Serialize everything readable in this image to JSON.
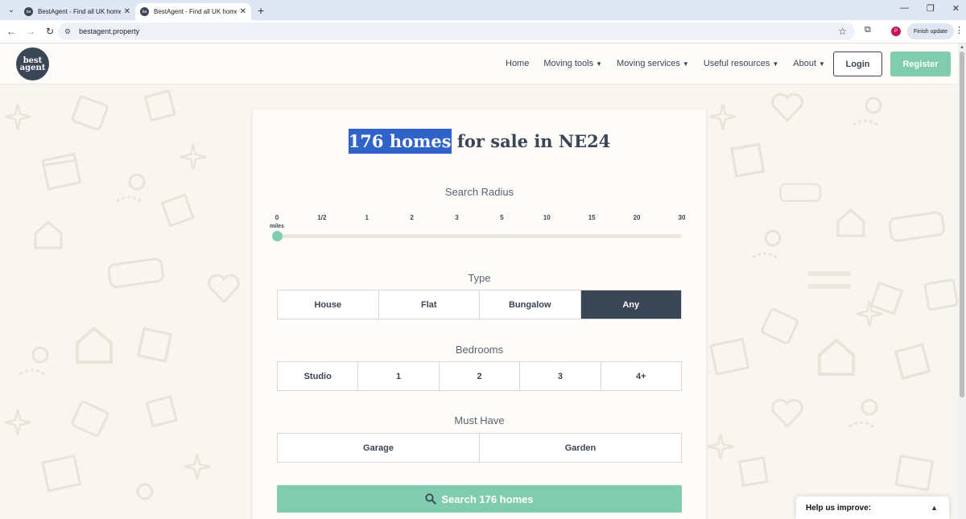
{
  "browser": {
    "tabs": [
      {
        "title": "BestAgent - Find all UK homes",
        "favicon": "ba"
      },
      {
        "title": "BestAgent - Find all UK homes",
        "favicon": "ba"
      }
    ],
    "address": "bestagent.property",
    "profile_initial": "P",
    "finish_update": "Finish update"
  },
  "header": {
    "logo_top": "best",
    "logo_bottom": "agent",
    "nav": [
      "Home",
      "Moving tools",
      "Moving services",
      "Useful resources",
      "About"
    ],
    "login": "Login",
    "register": "Register"
  },
  "search": {
    "headline_highlight": "176 homes",
    "headline_rest": " for sale in NE24",
    "radius_label": "Search Radius",
    "radius_ticks": [
      "0",
      "1/2",
      "1",
      "2",
      "3",
      "5",
      "10",
      "15",
      "20",
      "30"
    ],
    "radius_unit": "miles",
    "radius_selected": "0",
    "type_label": "Type",
    "types": [
      "House",
      "Flat",
      "Bungalow",
      "Any"
    ],
    "type_selected": "Any",
    "bedrooms_label": "Bedrooms",
    "bedrooms": [
      "Studio",
      "1",
      "2",
      "3",
      "4+"
    ],
    "must_have_label": "Must Have",
    "must_have": [
      "Garage",
      "Garden"
    ],
    "search_button": "Search 176 homes"
  },
  "help_widget": "Help us improve:",
  "colors": {
    "navy": "#3a4556",
    "mint": "#7fcdae",
    "highlight": "#2f63c9",
    "background": "#f8f6f0"
  }
}
